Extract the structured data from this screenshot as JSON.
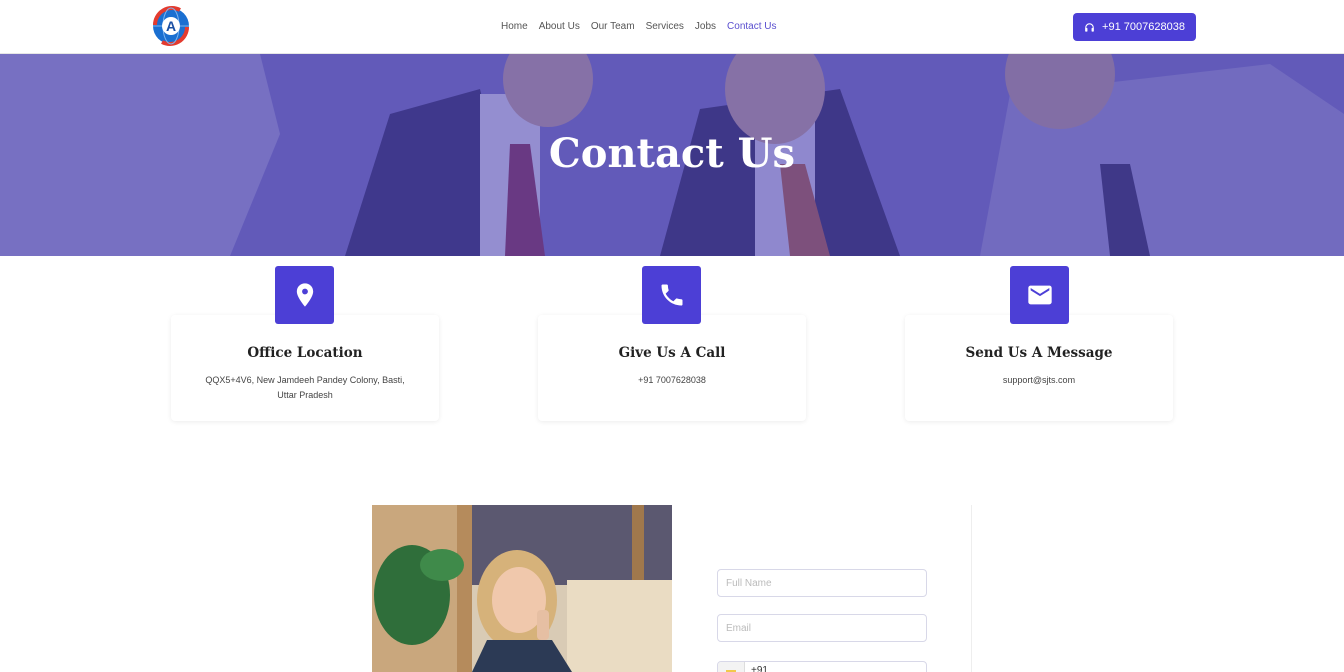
{
  "header": {
    "logo_letter": "A",
    "nav": [
      {
        "label": "Home"
      },
      {
        "label": "About Us"
      },
      {
        "label": "Our Team"
      },
      {
        "label": "Services"
      },
      {
        "label": "Jobs"
      },
      {
        "label": "Contact Us",
        "active": true
      }
    ],
    "phone_button": "+91 7007628038"
  },
  "hero": {
    "title": "Contact Us"
  },
  "cards": [
    {
      "icon": "location-pin-icon",
      "title": "Office Location",
      "text": "QQX5+4V6, New Jamdeeh Pandey Colony, Basti, Uttar Pradesh"
    },
    {
      "icon": "phone-icon",
      "title": "Give Us A Call",
      "text": "+91 7007628038"
    },
    {
      "icon": "envelope-icon",
      "title": "Send Us A Message",
      "text": "support@sjts.com"
    }
  ],
  "form": {
    "full_name_placeholder": "Full Name",
    "email_placeholder": "Email",
    "phone_code": "+91"
  },
  "colors": {
    "accent": "#4c3fd6",
    "nav_active": "#5a4fcf",
    "hero_overlay": "#4e44b2"
  }
}
